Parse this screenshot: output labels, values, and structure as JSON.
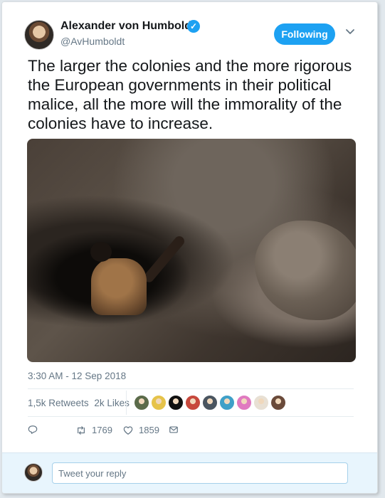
{
  "author": {
    "name": "Alexander von Humboldt",
    "handle": "@AvHumboldt",
    "verified_icon": "verified-badge-icon",
    "verified_glyph": "✓"
  },
  "follow_button": {
    "label": "Following"
  },
  "tweet": {
    "text": "The larger the colonies and the more rigorous the European governments in their political malice, all the more will the immorality of the colonies have to increase.",
    "timestamp": "3:30 AM - 12 Sep 2018"
  },
  "stats": {
    "retweets_count": "1,5k",
    "retweets_label": "Retweets",
    "likes_count": "2k",
    "likes_label": "Likes"
  },
  "actions": {
    "reply_icon": "reply-icon",
    "retweet_icon": "retweet-icon",
    "retweet_count": "1769",
    "like_icon": "heart-icon",
    "like_count": "1859",
    "dm_icon": "envelope-icon"
  },
  "reply": {
    "placeholder": "Tweet your reply"
  },
  "colors": {
    "accent": "#1da1f2",
    "text": "#14171a",
    "muted": "#657786",
    "reply_bar": "#e8f5fd"
  },
  "likers": [
    {
      "name": "liker-avatar",
      "color": "#5b6b4a"
    },
    {
      "name": "liker-avatar",
      "color": "#e6c34a"
    },
    {
      "name": "liker-avatar",
      "color": "#111111"
    },
    {
      "name": "liker-avatar",
      "color": "#c7483c"
    },
    {
      "name": "liker-avatar",
      "color": "#4a5560"
    },
    {
      "name": "liker-avatar",
      "color": "#3fa0c8"
    },
    {
      "name": "liker-avatar",
      "color": "#e07ac0"
    },
    {
      "name": "liker-avatar",
      "color": "#e8e0d4"
    },
    {
      "name": "liker-avatar",
      "color": "#6a4a3a"
    }
  ]
}
